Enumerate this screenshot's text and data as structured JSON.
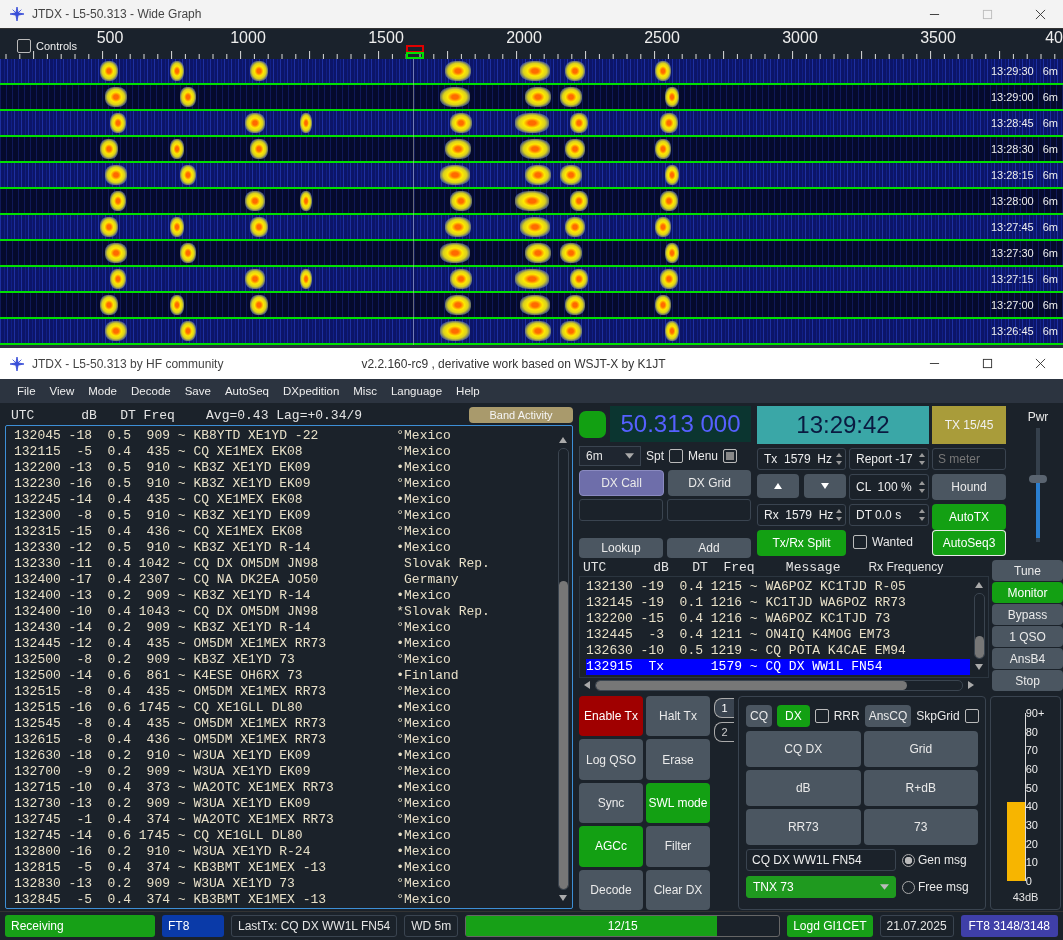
{
  "wide_graph": {
    "title": "JTDX - L5-50.313 - Wide Graph",
    "controls": {
      "label": "Controls",
      "checked": false
    },
    "scale": [
      "500",
      "1000",
      "1500",
      "2000",
      "2500",
      "3000",
      "3500",
      "40"
    ],
    "rows": [
      {
        "time": "13:29:30",
        "band": "6m"
      },
      {
        "time": "13:29:00",
        "band": "6m"
      },
      {
        "time": "13:28:45",
        "band": "6m"
      },
      {
        "time": "13:28:30",
        "band": "6m"
      },
      {
        "time": "13:28:15",
        "band": "6m"
      },
      {
        "time": "13:28:00",
        "band": "6m"
      },
      {
        "time": "13:27:45",
        "band": "6m"
      },
      {
        "time": "13:27:30",
        "band": "6m"
      },
      {
        "time": "13:27:15",
        "band": "6m"
      },
      {
        "time": "13:27:00",
        "band": "6m"
      },
      {
        "time": "13:26:45",
        "band": "6m"
      }
    ]
  },
  "main_window": {
    "title": "JTDX - L5-50.313   by HF community",
    "version": "v2.2.160-rc9 , derivative work based on WSJT-X by K1JT"
  },
  "menu": [
    "File",
    "View",
    "Mode",
    "Decode",
    "Save",
    "AutoSeq",
    "DXpedition",
    "Misc",
    "Language",
    "Help"
  ],
  "band_activity": {
    "header": "UTC      dB   DT Freq    Avg=0.43 Lag=+0.34/9",
    "button": "Band Activity",
    "rows": [
      {
        "t": "132045 -18  0.5  909 ~ KB8YTD XE1YD -22",
        "flag": "°",
        "country": "Mexico"
      },
      {
        "t": "132115  -5  0.4  435 ~ CQ XE1MEX EK08",
        "flag": "°",
        "country": "Mexico"
      },
      {
        "t": "132200 -13  0.5  910 ~ KB3Z XE1YD EK09",
        "flag": "•",
        "country": "Mexico"
      },
      {
        "t": "132230 -16  0.5  910 ~ KB3Z XE1YD EK09",
        "flag": "°",
        "country": "Mexico"
      },
      {
        "t": "132245 -14  0.4  435 ~ CQ XE1MEX EK08",
        "flag": "•",
        "country": "Mexico"
      },
      {
        "t": "132300  -8  0.5  910 ~ KB3Z XE1YD EK09",
        "flag": "°",
        "country": "Mexico"
      },
      {
        "t": "132315 -15  0.4  436 ~ CQ XE1MEX EK08",
        "flag": "°",
        "country": "Mexico"
      },
      {
        "t": "132330 -12  0.5  910 ~ KB3Z XE1YD R-14",
        "flag": "•",
        "country": "Mexico"
      },
      {
        "t": "132330 -11  0.4 1042 ~ CQ DX OM5DM JN98",
        "country": "Slovak Rep."
      },
      {
        "t": "132400 -17  0.4 2307 ~ CQ NA DK2EA JO50",
        "country": "Germany"
      },
      {
        "t": "132400 -13  0.2  909 ~ KB3Z XE1YD R-14",
        "flag": "•",
        "country": "Mexico"
      },
      {
        "t": "132400 -10  0.4 1043 ~ CQ DX OM5DM JN98",
        "flag": "*",
        "country": "Slovak Rep."
      },
      {
        "t": "132430 -14  0.2  909 ~ KB3Z XE1YD R-14",
        "flag": "°",
        "country": "Mexico"
      },
      {
        "t": "132445 -12  0.4  435 ~ OM5DM XE1MEX RR73",
        "flag": "•",
        "country": "Mexico"
      },
      {
        "t": "132500  -8  0.2  909 ~ KB3Z XE1YD 73",
        "flag": "°",
        "country": "Mexico"
      },
      {
        "t": "132500 -14  0.6  861 ~ K4ESE OH6RX 73",
        "flag": "•",
        "country": "Finland"
      },
      {
        "t": "132515  -8  0.4  435 ~ OM5DM XE1MEX RR73",
        "flag": "°",
        "country": "Mexico"
      },
      {
        "t": "132515 -16  0.6 1745 ~ CQ XE1GLL DL80",
        "flag": "•",
        "country": "Mexico"
      },
      {
        "t": "132545  -8  0.4  435 ~ OM5DM XE1MEX RR73",
        "flag": "°",
        "country": "Mexico"
      },
      {
        "t": "132615  -8  0.4  436 ~ OM5DM XE1MEX RR73",
        "flag": "°",
        "country": "Mexico"
      },
      {
        "t": "132630 -18  0.2  910 ~ W3UA XE1YD EK09",
        "flag": "•",
        "country": "Mexico"
      },
      {
        "t": "132700  -9  0.2  909 ~ W3UA XE1YD EK09",
        "flag": "°",
        "country": "Mexico"
      },
      {
        "t": "132715 -10  0.4  373 ~ WA2OTC XE1MEX RR73",
        "flag": "•",
        "country": "Mexico"
      },
      {
        "t": "132730 -13  0.2  909 ~ W3UA XE1YD EK09",
        "flag": "°",
        "country": "Mexico"
      },
      {
        "t": "132745  -1  0.4  374 ~ WA2OTC XE1MEX RR73",
        "flag": "°",
        "country": "Mexico"
      },
      {
        "t": "132745 -14  0.6 1745 ~ CQ XE1GLL DL80",
        "flag": "•",
        "country": "Mexico"
      },
      {
        "t": "132800 -16  0.2  910 ~ W3UA XE1YD R-24",
        "flag": "•",
        "country": "Mexico"
      },
      {
        "t": "132815  -5  0.4  374 ~ KB3BMT XE1MEX -13",
        "flag": "•",
        "country": "Mexico"
      },
      {
        "t": "132830 -13  0.2  909 ~ W3UA XE1YD 73",
        "flag": "°",
        "country": "Mexico"
      },
      {
        "t": "132845  -5  0.4  374 ~ KB3BMT XE1MEX -13",
        "flag": "°",
        "country": "Mexico"
      }
    ]
  },
  "frequency_display": "50.313 000",
  "clock": "13:29:42",
  "tx_period": "TX 15/45",
  "power": {
    "label": "Pwr",
    "level": 0.56
  },
  "band_combo": "6m",
  "spt": {
    "label": "Spt",
    "checked": false
  },
  "menu_toggle": {
    "label": "Menu",
    "checked": true
  },
  "tx_freq": "Tx  1579  Hz",
  "report": "Report -17",
  "s_meter_field": {
    "placeholder": "S meter"
  },
  "dx_call": "DX Call",
  "dx_grid": "DX Grid",
  "cl": "CL  100 %",
  "rx_freq": "Rx  1579  Hz",
  "dt": "DT 0.0 s",
  "hound": {
    "label": "Hound",
    "on": false
  },
  "autotx": {
    "label": "AutoTX",
    "on": true
  },
  "split": {
    "label": "Tx/Rx Split",
    "on": true
  },
  "wanted": {
    "label": "Wanted",
    "checked": false
  },
  "autoseq": {
    "label": "AutoSeq3",
    "on": true
  },
  "lookup": "Lookup",
  "add": "Add",
  "rx_frequency": {
    "header": "UTC      dB   DT  Freq    Message",
    "title": "Rx Frequency",
    "rows": [
      {
        "t": "132130 -19  0.4 1215 ~ WA6POZ KC1TJD R-05",
        "selected": false
      },
      {
        "t": "132145 -19  0.1 1216 ~ KC1TJD WA6POZ RR73",
        "selected": false
      },
      {
        "t": "132200 -15  0.4 1216 ~ WA6POZ KC1TJD 73",
        "selected": false
      },
      {
        "t": "132445  -3  0.4 1211 ~ ON4IQ K4MOG EM73",
        "selected": false
      },
      {
        "t": "132630 -10  0.5 1219 ~ CQ POTA K4CAE EM94",
        "selected": false
      },
      {
        "t": "132915  Tx      1579 ~ CQ DX WW1L FN54",
        "selected": true
      }
    ]
  },
  "side_buttons": [
    {
      "label": "Tune",
      "on": false
    },
    {
      "label": "Monitor",
      "on": true
    },
    {
      "label": "Bypass",
      "on": false
    },
    {
      "label": "1 QSO",
      "on": false
    },
    {
      "label": "AnsB4",
      "on": false
    },
    {
      "label": "Stop",
      "on": false
    }
  ],
  "control_buttons": [
    {
      "label": "Enable Tx",
      "kind": "enable",
      "on": true
    },
    {
      "label": "Halt Tx",
      "kind": "toggle",
      "on": false
    },
    {
      "label": "Log QSO",
      "kind": "toggle",
      "on": false
    },
    {
      "label": "Erase",
      "kind": "toggle",
      "on": false
    },
    {
      "label": "Sync",
      "kind": "toggle",
      "on": false
    },
    {
      "label": "SWL mode",
      "kind": "toggle",
      "on": true
    },
    {
      "label": "AGCc",
      "kind": "toggle",
      "on": true
    },
    {
      "label": "Filter",
      "kind": "toggle",
      "on": false
    },
    {
      "label": "Decode",
      "kind": "toggle",
      "on": false
    },
    {
      "label": "Clear DX",
      "kind": "toggle",
      "on": false
    }
  ],
  "tabs": [
    {
      "label": "1",
      "selected": true
    },
    {
      "label": "2",
      "selected": false
    }
  ],
  "messages": {
    "cq": {
      "label": "CQ",
      "on": false
    },
    "dx": {
      "label": "DX",
      "on": true
    },
    "rrr": {
      "label": "RRR",
      "checked": false
    },
    "anscq": "AnsCQ",
    "skpgrid": {
      "label": "SkpGrid",
      "checked": false
    },
    "buttons": [
      "CQ DX",
      "Grid",
      "dB",
      "R+dB",
      "RR73",
      "73"
    ],
    "gen_field": "CQ DX WW1L FN54",
    "free_combo": "TNX 73",
    "radios": [
      {
        "label": "Gen msg",
        "selected": true
      },
      {
        "label": "Free msg",
        "selected": false
      }
    ]
  },
  "s_meter": {
    "scale": [
      "90+",
      "80",
      "70",
      "60",
      "50",
      "40",
      "30",
      "20",
      "10",
      "0"
    ],
    "level": 0.47,
    "reading": "43dB"
  },
  "status": {
    "state": "Receiving",
    "mode": "FT8",
    "last_tx": "LastTx: CQ DX WW1L FN54",
    "wd": "WD 5m",
    "progress": {
      "text": "12/15",
      "level": 0.8
    },
    "logged": "Logd GI1CET",
    "date": "21.07.2025",
    "counter": "FT8  3148/3148"
  }
}
